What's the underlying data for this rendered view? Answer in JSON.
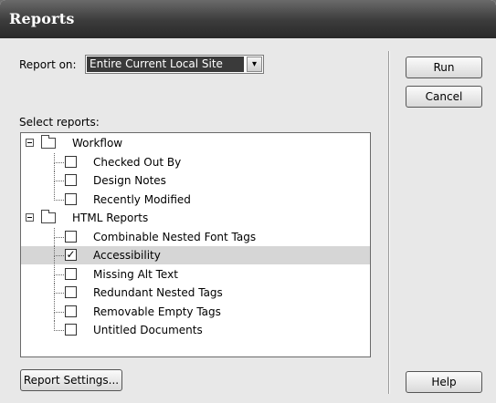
{
  "window": {
    "title": "Reports"
  },
  "report_on": {
    "label": "Report on:",
    "selected": "Entire Current Local Site"
  },
  "select_reports": {
    "label": "Select reports:",
    "groups": [
      {
        "name": "Workflow",
        "items": [
          {
            "label": "Checked Out By",
            "checked": false
          },
          {
            "label": "Design Notes",
            "checked": false
          },
          {
            "label": "Recently Modified",
            "checked": false
          }
        ]
      },
      {
        "name": "HTML Reports",
        "items": [
          {
            "label": "Combinable Nested Font Tags",
            "checked": false
          },
          {
            "label": "Accessibility",
            "checked": true,
            "selected": true
          },
          {
            "label": "Missing Alt Text",
            "checked": false
          },
          {
            "label": "Redundant Nested Tags",
            "checked": false
          },
          {
            "label": "Removable Empty Tags",
            "checked": false
          },
          {
            "label": "Untitled Documents",
            "checked": false
          }
        ]
      }
    ]
  },
  "buttons": {
    "run": "Run",
    "cancel": "Cancel",
    "report_settings": "Report Settings...",
    "help": "Help"
  },
  "icons": {
    "expander": "collapse-box-icon",
    "folder": "folder-icon",
    "dropdown": "chevron-down-icon",
    "check": "checkmark-icon"
  }
}
